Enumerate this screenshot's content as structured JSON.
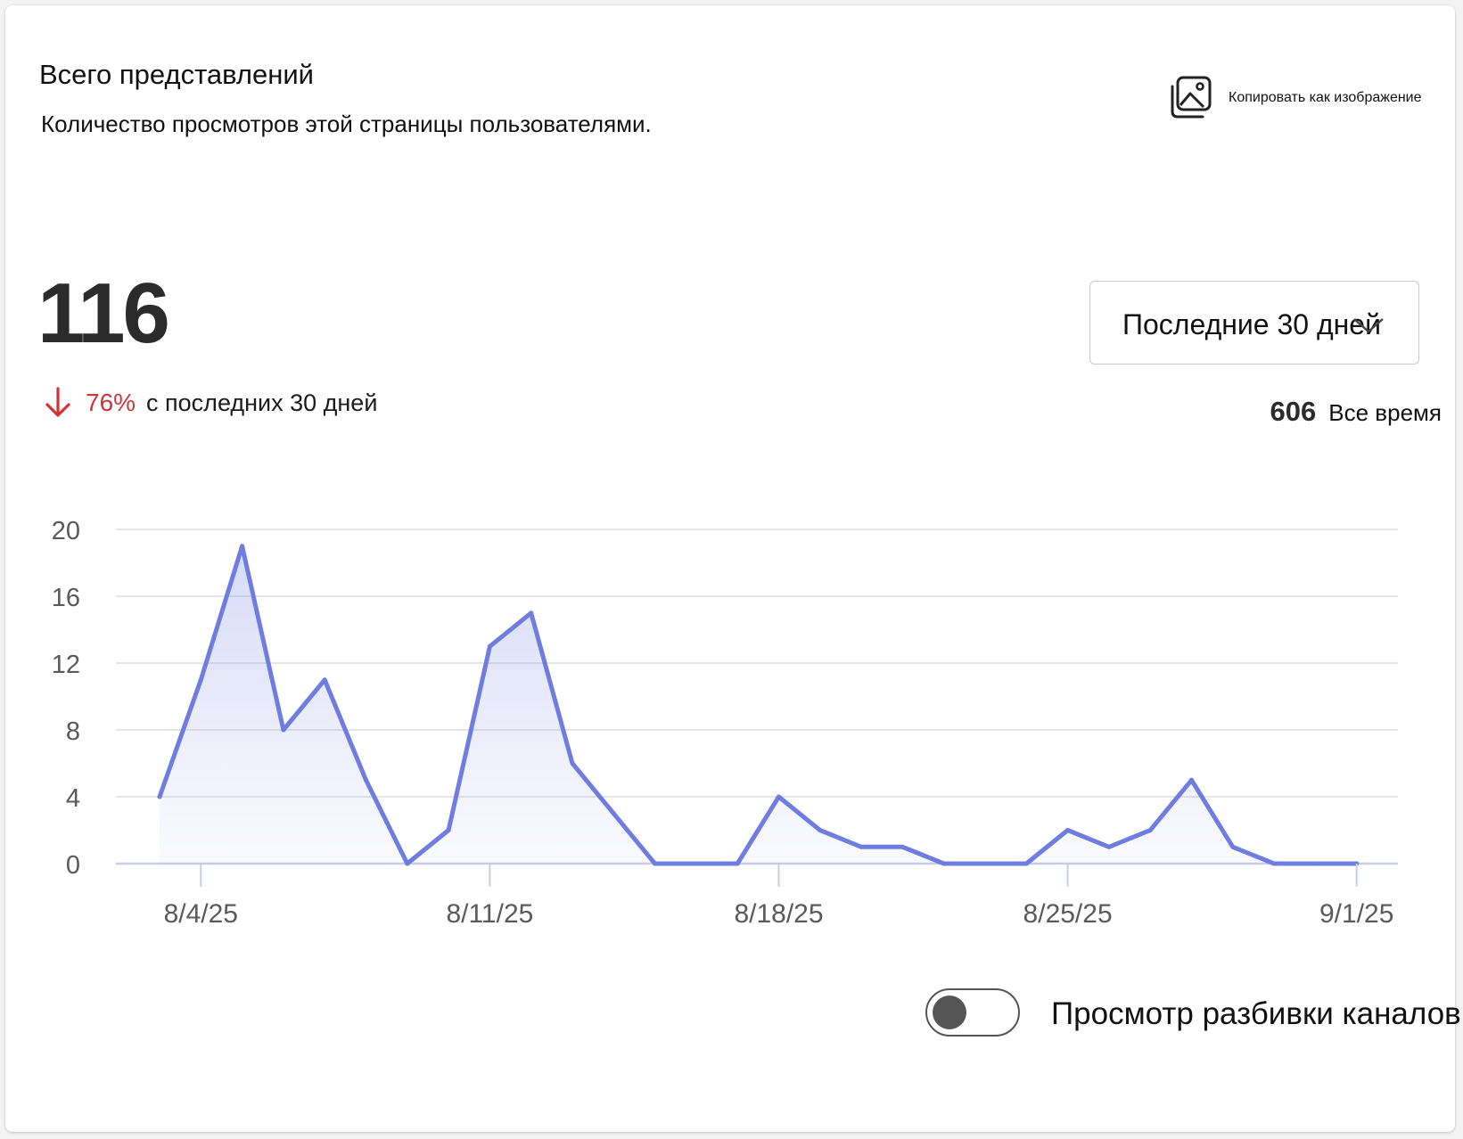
{
  "header": {
    "title": "Всего представлений",
    "subtitle": "Количество просмотров этой страницы пользователями.",
    "copy_label": "Копировать как изображение",
    "copy_icon": "image-copy-icon"
  },
  "summary": {
    "total": "116",
    "change_pct": "76%",
    "change_text": "с последних 30 дней",
    "change_direction": "down",
    "change_color": "#d13438"
  },
  "range": {
    "selected": "Последние 30 дней"
  },
  "alltime": {
    "value": "606",
    "label": "Все время"
  },
  "toggle": {
    "label": "Просмотр разбивки каналов",
    "on": false
  },
  "colors": {
    "line": "#6f7de0",
    "grid": "#e6e6e6",
    "axis": "#c9cde8"
  },
  "chart_data": {
    "type": "area",
    "title": "",
    "xlabel": "",
    "ylabel": "",
    "ylim": [
      0,
      20
    ],
    "yticks": [
      0,
      4,
      8,
      12,
      16,
      20
    ],
    "x": [
      "8/3/25",
      "8/4/25",
      "8/5/25",
      "8/6/25",
      "8/7/25",
      "8/8/25",
      "8/9/25",
      "8/10/25",
      "8/11/25",
      "8/12/25",
      "8/13/25",
      "8/14/25",
      "8/15/25",
      "8/16/25",
      "8/17/25",
      "8/18/25",
      "8/19/25",
      "8/20/25",
      "8/21/25",
      "8/22/25",
      "8/23/25",
      "8/24/25",
      "8/25/25",
      "8/26/25",
      "8/27/25",
      "8/28/25",
      "8/29/25",
      "8/30/25",
      "8/31/25",
      "9/1/25"
    ],
    "xticks": [
      "8/4/25",
      "8/11/25",
      "8/18/25",
      "8/25/25",
      "9/1/25"
    ],
    "values": [
      4,
      11,
      19,
      8,
      11,
      5,
      0,
      2,
      13,
      15,
      6,
      3,
      0,
      0,
      0,
      4,
      2,
      1,
      1,
      0,
      0,
      0,
      2,
      1,
      2,
      5,
      1,
      0,
      0,
      0
    ],
    "grid": true,
    "legend": "none"
  }
}
